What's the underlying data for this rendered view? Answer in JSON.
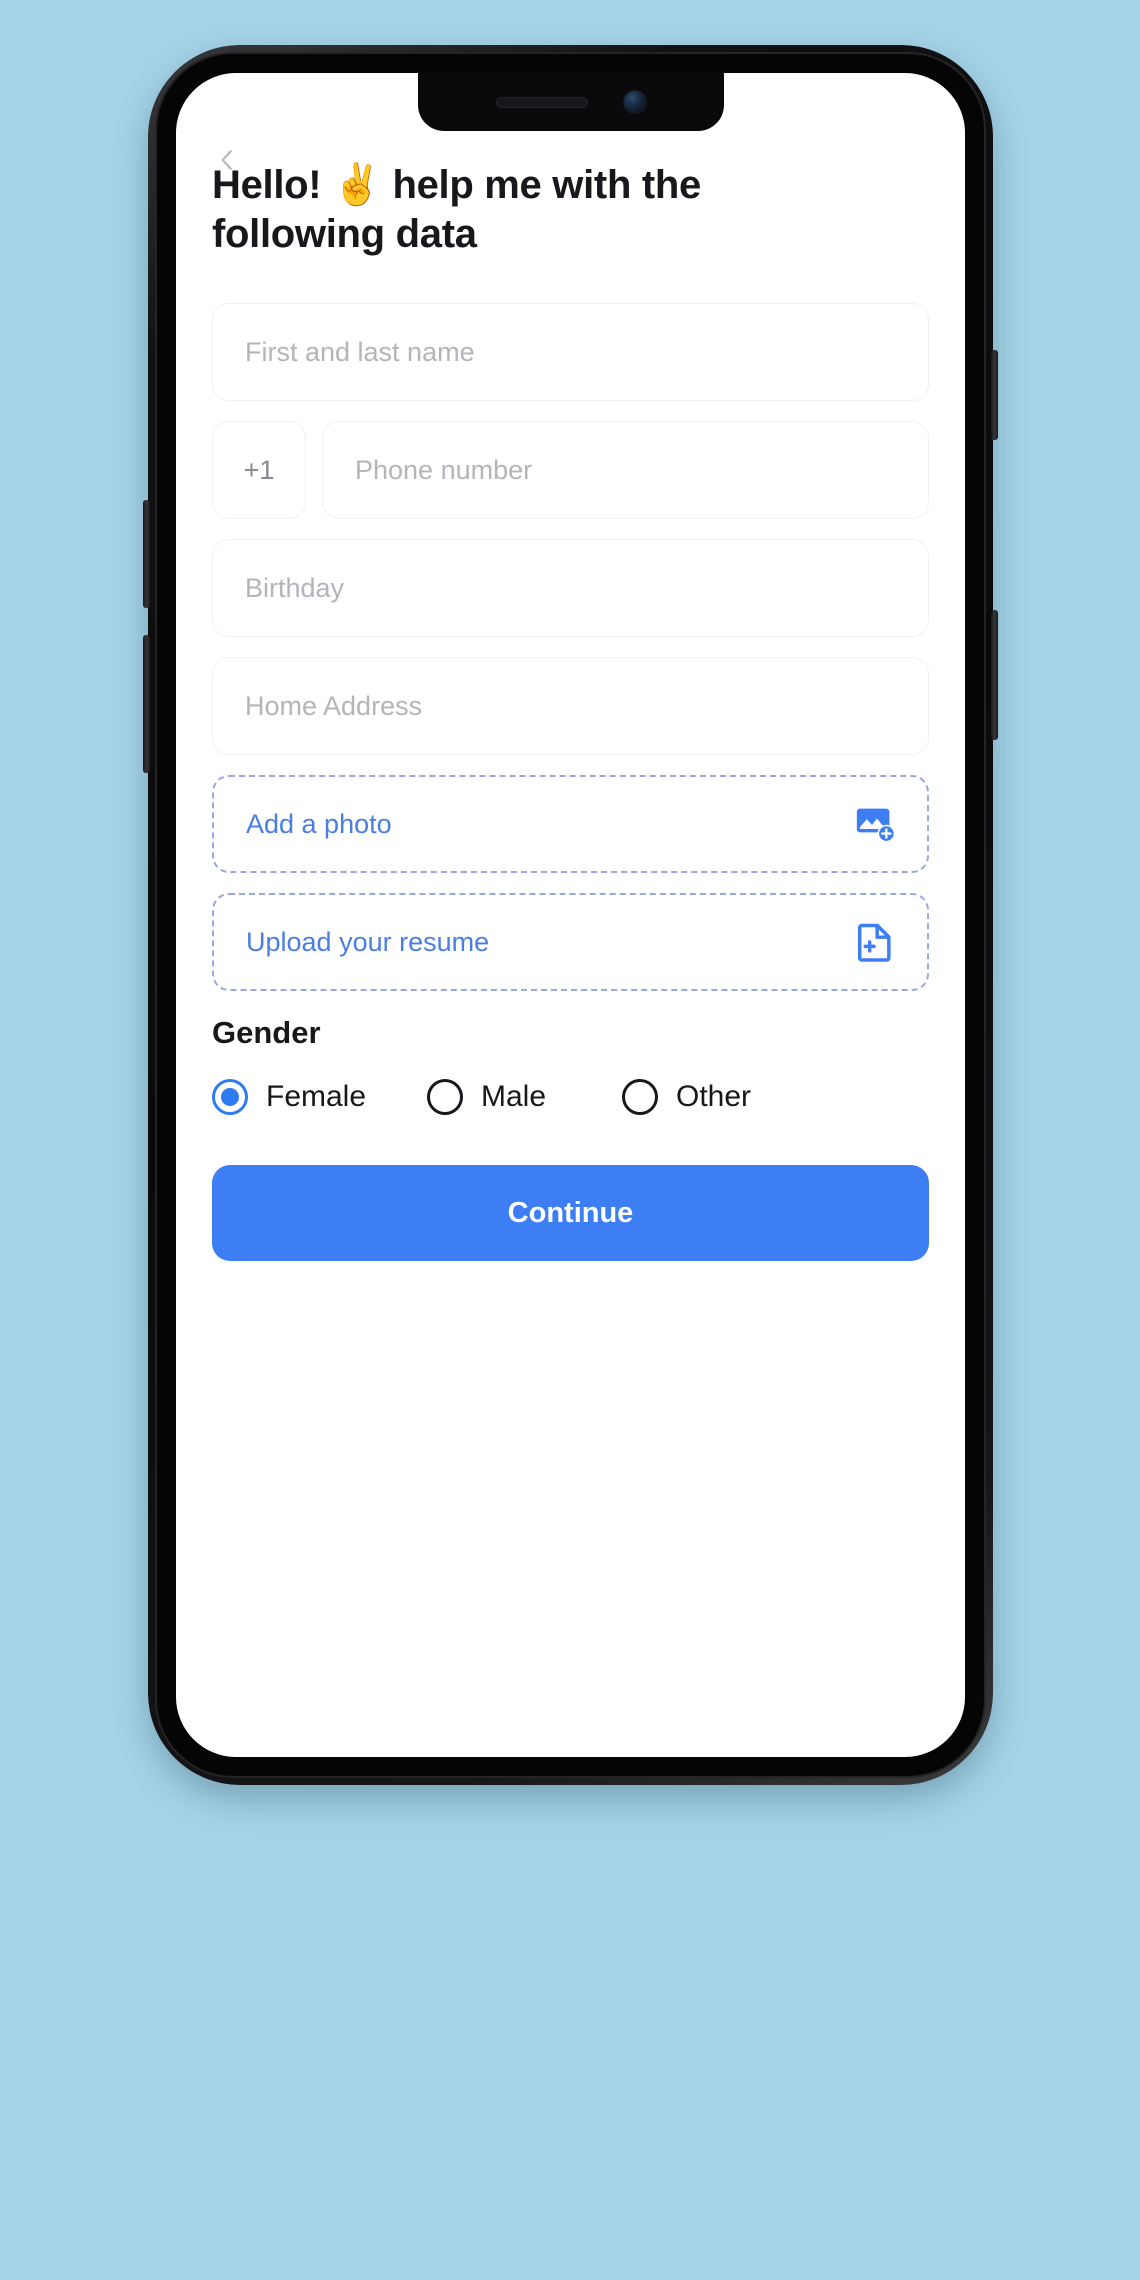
{
  "theme": {
    "background": "#a5d4e8",
    "accent": "#3d7ef5",
    "link": "#4a7fe0",
    "dashed_border": "#9aa8e0",
    "placeholder": "#b2b5ba",
    "text": "#16181c"
  },
  "nav": {
    "back_icon": "chevron-left-icon"
  },
  "header": {
    "title": "Hello! ✌️ help me with the following data"
  },
  "form": {
    "name_field": {
      "placeholder": "First and last name",
      "value": ""
    },
    "phone": {
      "country_code": "+1",
      "placeholder": "Phone number",
      "value": ""
    },
    "birthday_field": {
      "placeholder": "Birthday",
      "value": ""
    },
    "address_field": {
      "placeholder": "Home Address",
      "value": ""
    },
    "uploads": [
      {
        "label": "Add a photo",
        "icon": "add-image-icon"
      },
      {
        "label": "Upload your resume",
        "icon": "add-document-icon"
      }
    ],
    "gender": {
      "title": "Gender",
      "selected": "Female",
      "options": [
        {
          "label": "Female",
          "selected": true
        },
        {
          "label": "Male",
          "selected": false
        },
        {
          "label": "Other",
          "selected": false
        }
      ]
    },
    "submit_label": "Continue"
  }
}
